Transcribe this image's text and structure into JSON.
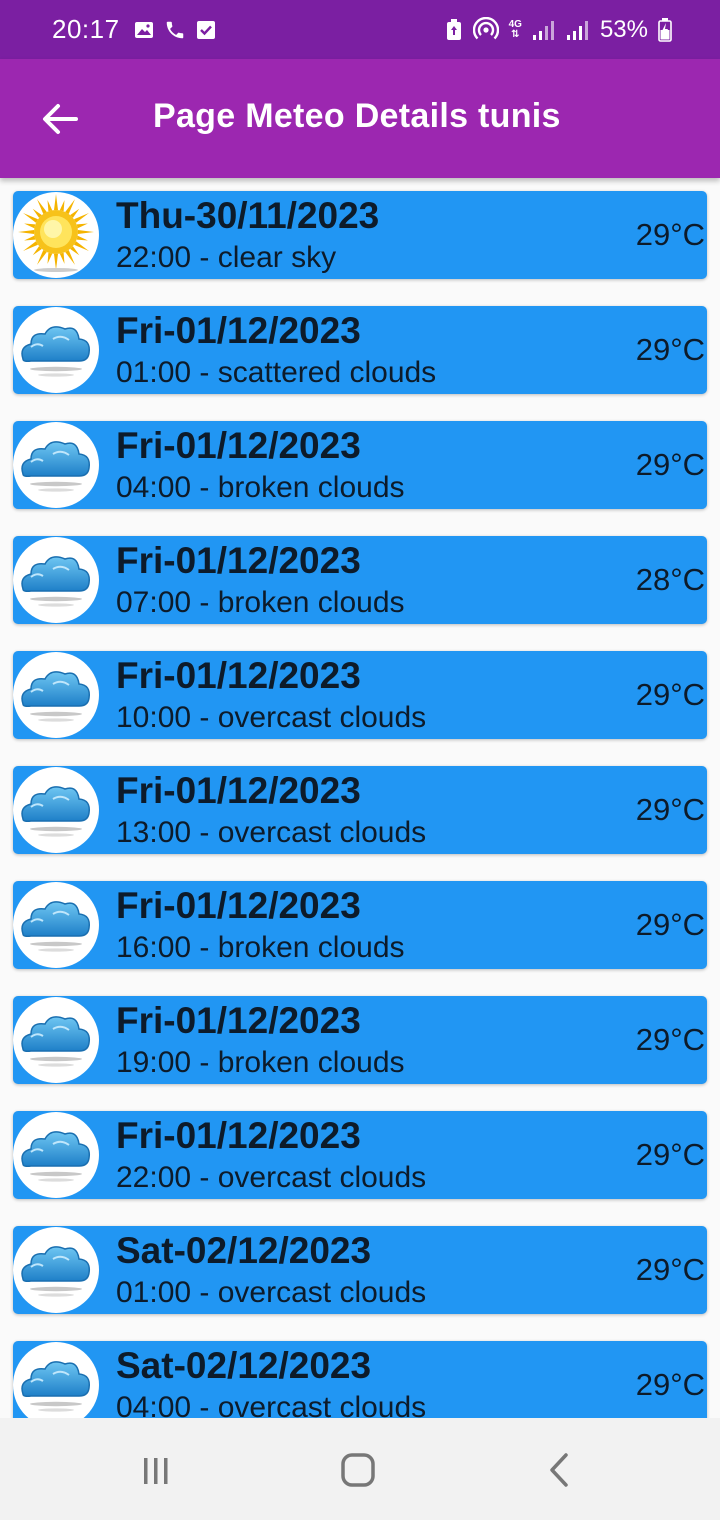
{
  "status_bar": {
    "time": "20:17",
    "battery_percent": "53%",
    "network_label": "4G",
    "icons": [
      "image-icon",
      "phone-icon",
      "check-box-icon",
      "battery-saver-icon",
      "hotspot-icon",
      "signal-icon",
      "signal-icon",
      "battery-charging-icon"
    ]
  },
  "app_bar": {
    "title": "Page Meteo Details tunis",
    "back_icon": "arrow-back-icon"
  },
  "colors": {
    "status_bar": "#7b1fa2",
    "app_bar": "#9c27b0",
    "card": "#2196f3",
    "text": "#0d1b2a",
    "background": "#fafafa"
  },
  "forecast": [
    {
      "date": "Thu-30/11/2023",
      "desc": "22:00 - clear sky",
      "temp": "29°C",
      "icon": "sun-icon"
    },
    {
      "date": "Fri-01/12/2023",
      "desc": "01:00 - scattered clouds",
      "temp": "29°C",
      "icon": "cloud-icon"
    },
    {
      "date": "Fri-01/12/2023",
      "desc": "04:00 - broken clouds",
      "temp": "29°C",
      "icon": "cloud-icon"
    },
    {
      "date": "Fri-01/12/2023",
      "desc": "07:00 - broken clouds",
      "temp": "28°C",
      "icon": "cloud-icon"
    },
    {
      "date": "Fri-01/12/2023",
      "desc": "10:00 - overcast clouds",
      "temp": "29°C",
      "icon": "cloud-icon"
    },
    {
      "date": "Fri-01/12/2023",
      "desc": "13:00 - overcast clouds",
      "temp": "29°C",
      "icon": "cloud-icon"
    },
    {
      "date": "Fri-01/12/2023",
      "desc": "16:00 - broken clouds",
      "temp": "29°C",
      "icon": "cloud-icon"
    },
    {
      "date": "Fri-01/12/2023",
      "desc": "19:00 - broken clouds",
      "temp": "29°C",
      "icon": "cloud-icon"
    },
    {
      "date": "Fri-01/12/2023",
      "desc": "22:00 - overcast clouds",
      "temp": "29°C",
      "icon": "cloud-icon"
    },
    {
      "date": "Sat-02/12/2023",
      "desc": "01:00 - overcast clouds",
      "temp": "29°C",
      "icon": "cloud-icon"
    },
    {
      "date": "Sat-02/12/2023",
      "desc": "04:00 - overcast clouds",
      "temp": "29°C",
      "icon": "cloud-icon"
    }
  ],
  "nav_bar": {
    "buttons": [
      "recent-apps-icon",
      "home-icon",
      "back-icon"
    ]
  }
}
